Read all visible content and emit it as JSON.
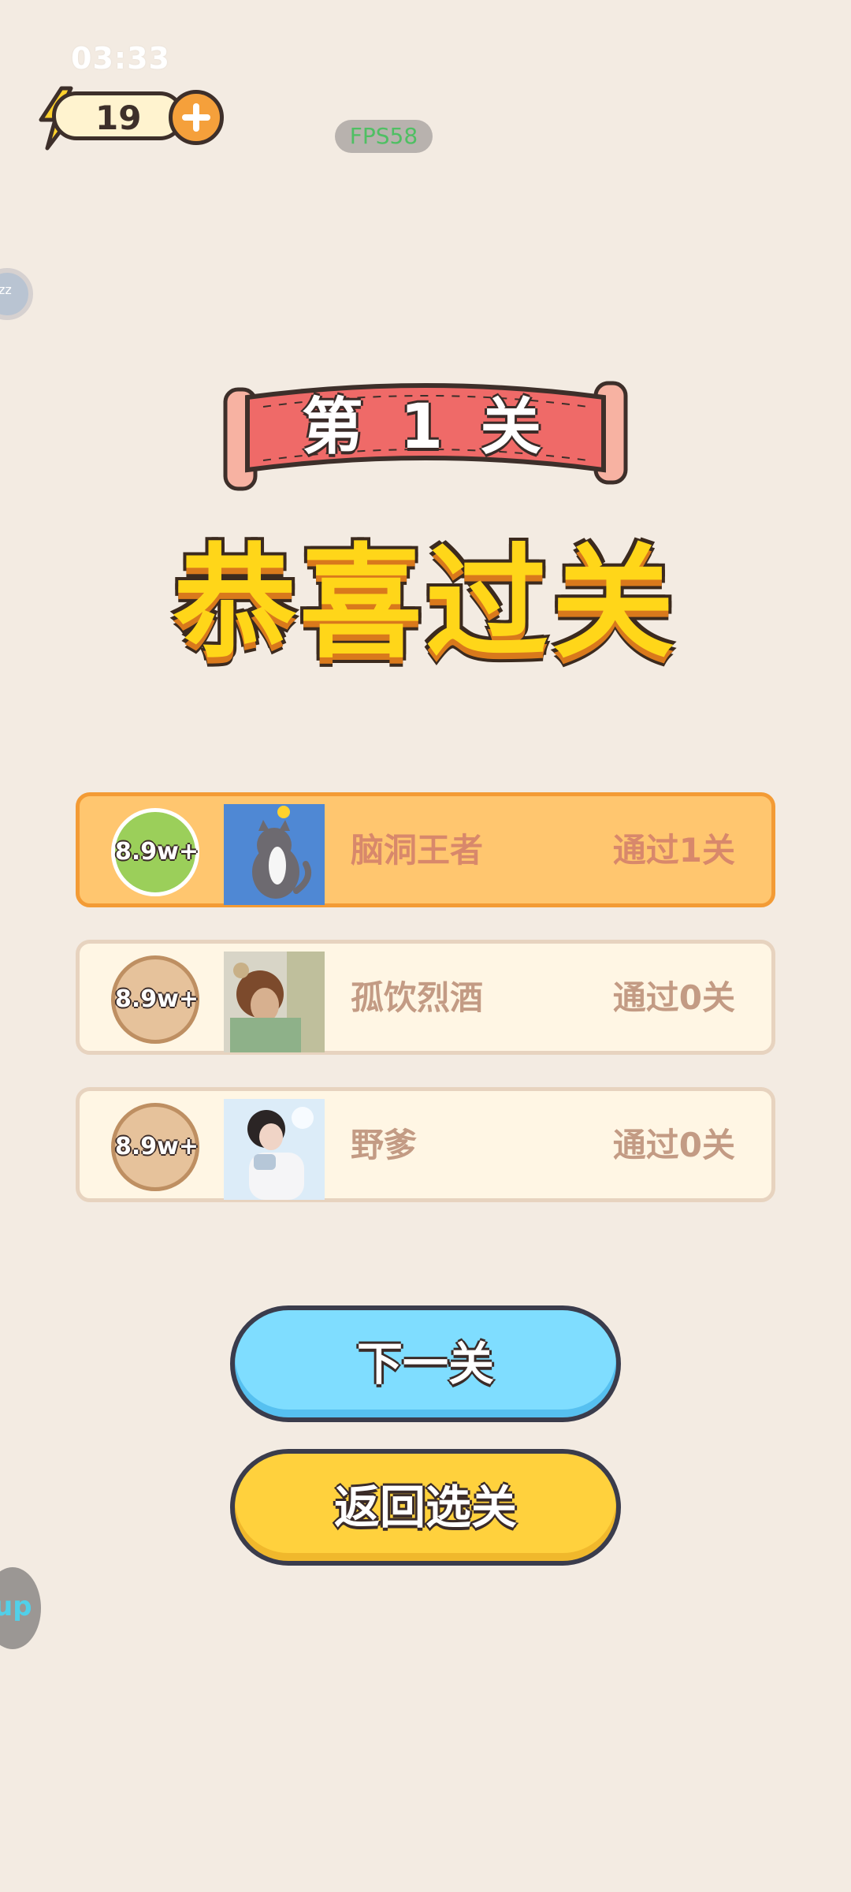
{
  "status_bar": {
    "time": "03:33"
  },
  "energy": {
    "count": "19",
    "icon": "lightning-icon"
  },
  "fps": {
    "label": "FPS58"
  },
  "floating": {
    "top_label": "zz",
    "bottom_label": "up"
  },
  "level": {
    "label": "第 1 关"
  },
  "title": {
    "text": "恭喜过关"
  },
  "ranking": {
    "rows": [
      {
        "score": "8.9w+",
        "name": "脑洞王者",
        "progress": "通过1关"
      },
      {
        "score": "8.9w+",
        "name": "孤饮烈酒",
        "progress": "通过0关"
      },
      {
        "score": "8.9w+",
        "name": "野爹",
        "progress": "通过0关"
      }
    ]
  },
  "buttons": {
    "next": "下一关",
    "back": "返回选关"
  }
}
